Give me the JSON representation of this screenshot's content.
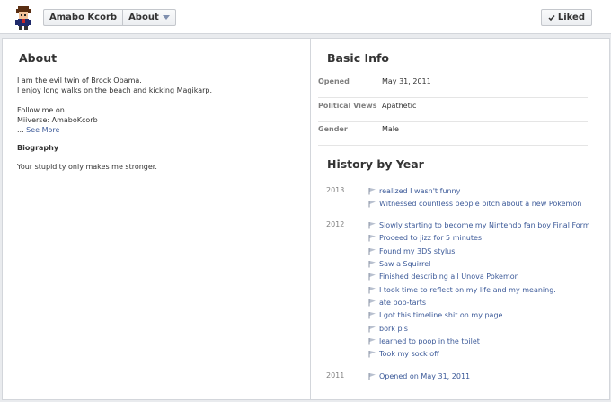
{
  "header": {
    "name": "Amabo Kcorb",
    "section": "About",
    "liked_label": "Liked"
  },
  "about": {
    "title": "About",
    "lines": [
      "I am the evil twin of Brock Obama.",
      "I enjoy long walks on the beach and kicking Magikarp.",
      "Follow me on",
      "Miiverse: AmaboKcorb"
    ],
    "see_more_prefix": "... ",
    "see_more": "See More",
    "biography_title": "Biography",
    "biography": "Your stupidity only makes me stronger."
  },
  "basic_info": {
    "title": "Basic Info",
    "rows": [
      {
        "label": "Opened",
        "value": "May 31, 2011"
      },
      {
        "label": "Political Views",
        "value": "Apathetic"
      },
      {
        "label": "Gender",
        "value": "Male"
      }
    ]
  },
  "history": {
    "title": "History by Year",
    "years": [
      {
        "year": "2013",
        "events": [
          "realized I wasn't funny",
          "Witnessed countless people bitch about a new Pokemon"
        ]
      },
      {
        "year": "2012",
        "events": [
          "Slowly starting to become my Nintendo fan boy Final Form",
          "Proceed to jizz for 5 minutes",
          "Found my 3DS stylus",
          "Saw a Squirrel",
          "Finished describing all Unova Pokemon",
          "I took time to reflect on my life and my meaning.",
          "ate pop-tarts",
          "I got this timeline shit on my page.",
          "bork pls",
          "learned to poop in the toilet",
          "Took my sock off"
        ]
      },
      {
        "year": "2011",
        "events": [
          "Opened on May 31, 2011"
        ]
      }
    ]
  }
}
